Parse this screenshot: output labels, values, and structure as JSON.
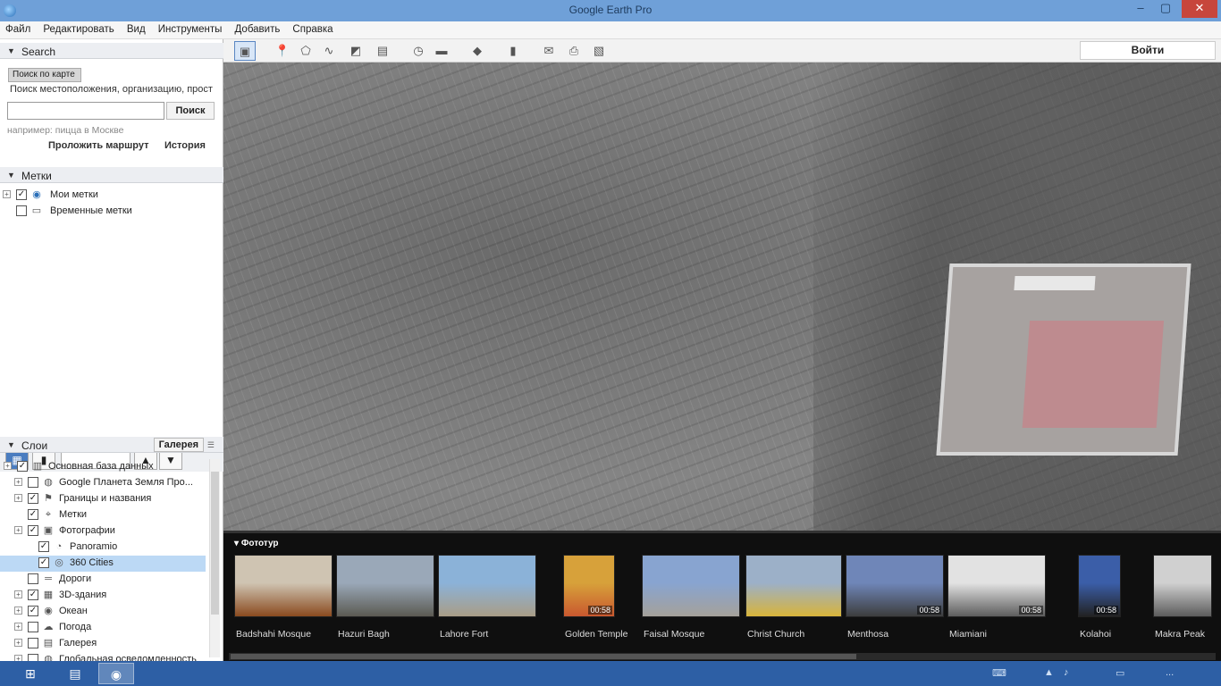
{
  "titlebar": {
    "title": "Google Earth Pro",
    "minimize_icon": "minimize-icon",
    "maximize_icon": "maximize-icon",
    "close_icon": "close-icon"
  },
  "menu": [
    "Файл",
    "Редактировать",
    "Вид",
    "Инструменты",
    "Добавить",
    "Справка"
  ],
  "search_panel": {
    "header": "Search",
    "tab_label": "Поиск по карте",
    "hint": "Поиск местоположения, организацию, прост",
    "input_value": "",
    "button": "Поиск",
    "example": "например: пицца в Москве",
    "route_link": "Проложить маршрут",
    "history_link": "История"
  },
  "places_panel": {
    "header": "Метки",
    "items": [
      {
        "label": "Мои метки",
        "checked": true,
        "icon": "globe-icon"
      },
      {
        "label": "Временные метки",
        "checked": false,
        "icon": "folder-icon"
      }
    ]
  },
  "layers_panel": {
    "header": "Слои",
    "gallery_button": "Галерея",
    "items": [
      {
        "label": "Основная база данных",
        "checked": true,
        "indent": 0,
        "expandable": true,
        "selected": false,
        "icon": "database-icon"
      },
      {
        "label": "Google Планета Земля Про...",
        "checked": false,
        "indent": 1,
        "expandable": true,
        "selected": false,
        "icon": "earth-icon"
      },
      {
        "label": "Границы и названия",
        "checked": true,
        "indent": 1,
        "expandable": true,
        "selected": false,
        "icon": "flag-icon"
      },
      {
        "label": "Метки",
        "checked": true,
        "indent": 1,
        "expandable": false,
        "selected": false,
        "icon": "placemark-icon"
      },
      {
        "label": "Фотографии",
        "checked": true,
        "indent": 1,
        "expandable": true,
        "selected": false,
        "icon": "camera-icon"
      },
      {
        "label": "Panoramio",
        "checked": true,
        "indent": 2,
        "expandable": false,
        "selected": false,
        "icon": "panoramio-icon"
      },
      {
        "label": "360 Cities",
        "checked": true,
        "indent": 2,
        "expandable": false,
        "selected": true,
        "icon": "360-icon"
      },
      {
        "label": "Дороги",
        "checked": false,
        "indent": 1,
        "expandable": false,
        "selected": false,
        "icon": "road-icon"
      },
      {
        "label": "3D-здания",
        "checked": true,
        "indent": 1,
        "expandable": true,
        "selected": false,
        "icon": "building-icon"
      },
      {
        "label": "Океан",
        "checked": true,
        "indent": 1,
        "expandable": true,
        "selected": false,
        "icon": "ocean-icon"
      },
      {
        "label": "Погода",
        "checked": false,
        "indent": 1,
        "expandable": true,
        "selected": false,
        "icon": "weather-icon"
      },
      {
        "label": "Галерея",
        "checked": false,
        "indent": 1,
        "expandable": true,
        "selected": false,
        "icon": "gallery-icon"
      },
      {
        "label": "Глобальная осведомленность",
        "checked": false,
        "indent": 1,
        "expandable": true,
        "selected": false,
        "icon": "globe-icon"
      }
    ]
  },
  "toolbar": {
    "sign_in": "Войти"
  },
  "photostrip": {
    "caption": "Фототур",
    "photos": [
      {
        "title": "Badshahi Mosque",
        "duration": "",
        "color_top": "#cfc4b2",
        "color_bottom": "#8a4a1f"
      },
      {
        "title": "Hazuri Bagh",
        "duration": "",
        "color_top": "#9aa8b8",
        "color_bottom": "#5b5a52"
      },
      {
        "title": "Lahore Fort",
        "duration": "",
        "color_top": "#8bb2d8",
        "color_bottom": "#a99d86"
      },
      {
        "title": "Golden Temple",
        "duration": "00:58",
        "color_top": "#d7a13a",
        "color_bottom": "#c9582f"
      },
      {
        "title": "Faisal Mosque",
        "duration": "",
        "color_top": "#88a4d0",
        "color_bottom": "#a5a19a"
      },
      {
        "title": "Christ Church",
        "duration": "",
        "color_top": "#9cb0c8",
        "color_bottom": "#d8b43a"
      },
      {
        "title": "Menthosa",
        "duration": "00:58",
        "color_top": "#6f86b8",
        "color_bottom": "#3d3d3d"
      },
      {
        "title": "Miamiani",
        "duration": "00:58",
        "color_top": "#e2e2e2",
        "color_bottom": "#5d5d5d"
      },
      {
        "title": "Kolahoi",
        "duration": "00:58",
        "color_top": "#3b5ea8",
        "color_bottom": "#222"
      },
      {
        "title": "Makra Peak",
        "duration": "",
        "color_top": "#d0d0d0",
        "color_bottom": "#5c5c5c"
      }
    ]
  },
  "taskbar": {
    "clock": "..."
  }
}
